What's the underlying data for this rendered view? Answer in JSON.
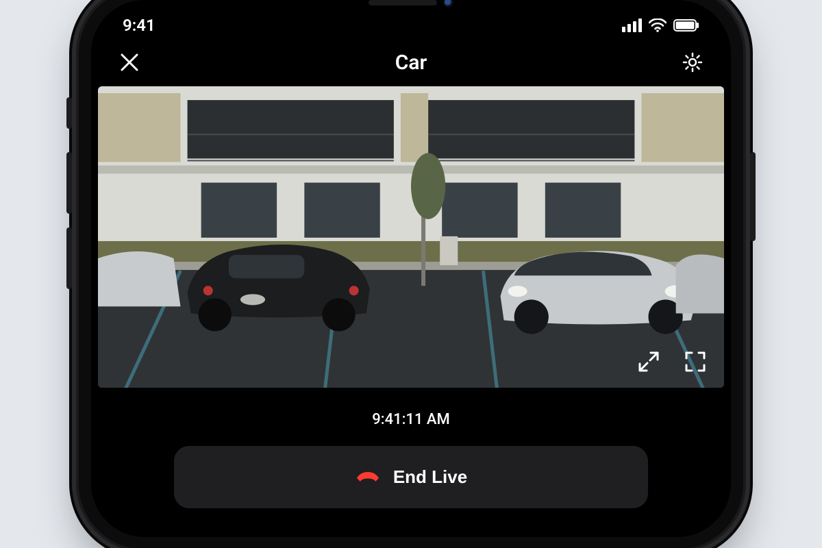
{
  "status": {
    "time": "9:41"
  },
  "nav": {
    "title": "Car"
  },
  "feed": {
    "timestamp": "9:41:11 AM"
  },
  "actions": {
    "end_live": "End Live"
  },
  "icons": {
    "close": "close-icon",
    "settings": "gear-icon",
    "expand": "expand-icon",
    "fullscreen": "fullscreen-icon",
    "hangup": "hangup-icon",
    "signal": "cell-signal-icon",
    "wifi": "wifi-icon",
    "battery": "battery-icon"
  }
}
